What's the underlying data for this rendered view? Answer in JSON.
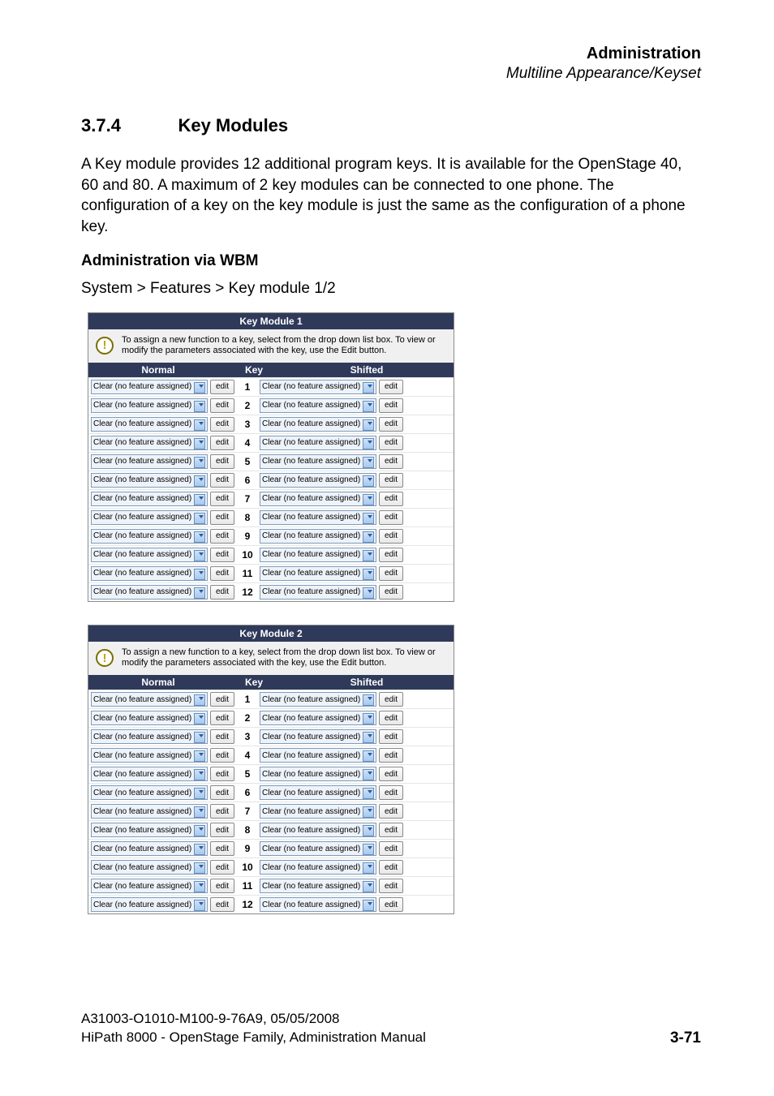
{
  "header": {
    "title": "Administration",
    "subtitle": "Multiline Appearance/Keyset"
  },
  "section": {
    "number": "3.7.4",
    "title": "Key Modules"
  },
  "paragraph": "A Key module provides 12 additional program keys. It is available for the OpenStage 40, 60 and 80. A maximum of 2 key modules can be connected to one phone. The configuration of a key on the key module is just the same as the configuration of a phone key.",
  "subheading": "Administration via WBM",
  "path": "System > Features > Key module 1/2",
  "km_info_text": "To assign a new function to a key, select from the drop down list box. To view or modify the parameters associated with the key, use the Edit button.",
  "cols": {
    "normal": "Normal",
    "key": "Key",
    "shifted": "Shifted"
  },
  "option_text": "Clear (no feature assigned)",
  "edit_label": "edit",
  "modules": [
    {
      "title": "Key Module 1",
      "keys": [
        1,
        2,
        3,
        4,
        5,
        6,
        7,
        8,
        9,
        10,
        11,
        12
      ]
    },
    {
      "title": "Key Module 2",
      "keys": [
        1,
        2,
        3,
        4,
        5,
        6,
        7,
        8,
        9,
        10,
        11,
        12
      ]
    }
  ],
  "footer": {
    "line1": "A31003-O1010-M100-9-76A9, 05/05/2008",
    "line2": "HiPath 8000 - OpenStage Family, Administration Manual",
    "page": "3-71"
  }
}
